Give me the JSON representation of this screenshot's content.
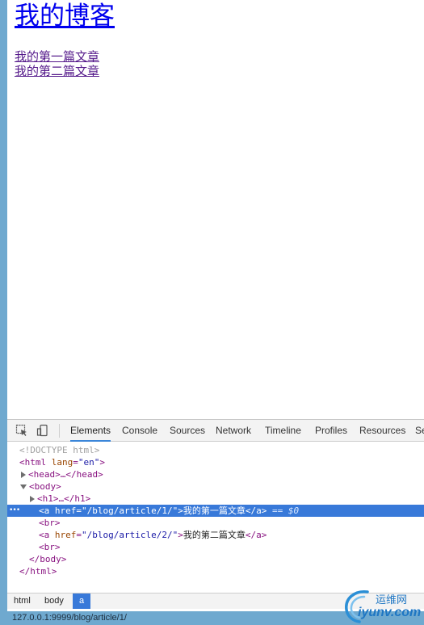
{
  "page": {
    "heading": "我的博客",
    "links": [
      "我的第一篇文章",
      "我的第二篇文章"
    ]
  },
  "devtools": {
    "tabs": [
      "Elements",
      "Console",
      "Sources",
      "Network",
      "Timeline",
      "Profiles",
      "Resources",
      "Se"
    ],
    "active_tab": "Elements",
    "dom": {
      "doctype": "<!DOCTYPE html>",
      "html_open": "<html",
      "lang_attr": "lang",
      "lang_val": "\"en\"",
      "html_close_bracket": ">",
      "head_collapsed": "<head>…</head>",
      "body_open": "<body>",
      "h1_collapsed": "<h1>…</h1>",
      "a_open": "<a",
      "href_attr": "href",
      "href1": "\"/blog/article/1/\"",
      "href2": "\"/blog/article/2/\"",
      "gt": ">",
      "a_text1": "我的第一篇文章",
      "a_text2": "我的第二篇文章",
      "a_close": "</a>",
      "selected_ref": "== $0",
      "br": "<br>",
      "body_close": "</body>",
      "html_close": "</html>"
    },
    "breadcrumbs": [
      "html",
      "body",
      "a"
    ],
    "active_breadcrumb": "a"
  },
  "status_url": "127.0.0.1:9999/blog/article/1/",
  "watermark": {
    "cn": "运维网",
    "en": "iyunv.com"
  },
  "colors": {
    "accent": "#3879d9",
    "frame": "#6fa9cf",
    "link": "#0000ee",
    "visited": "#551a8b"
  }
}
